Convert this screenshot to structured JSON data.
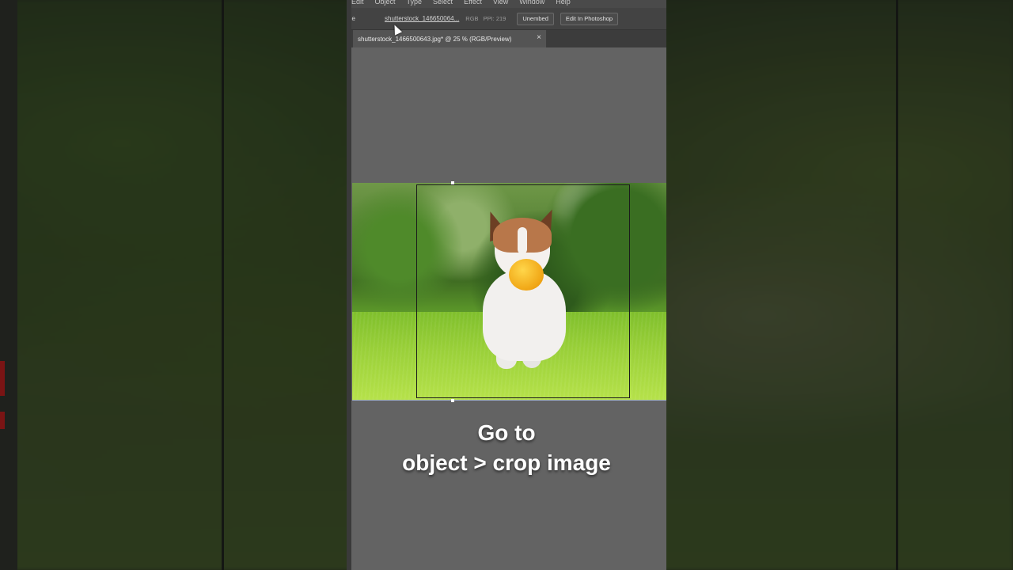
{
  "app": {
    "menu": [
      "Edit",
      "Object",
      "Type",
      "Select",
      "Effect",
      "View",
      "Window",
      "Help"
    ],
    "control_bar": {
      "image_label": "ge",
      "file_name": "shutterstock_146650064...",
      "color_mode": "RGB",
      "ppi": "PPI: 219",
      "unembed_button": "Unembed",
      "edit_photoshop_button": "Edit In Photoshop"
    },
    "document_tab": {
      "title": "shutterstock_1466500643.jpg* @ 25 % (RGB/Preview)",
      "close": "×"
    }
  },
  "caption": {
    "line1": "Go to",
    "line2": "object > crop image"
  },
  "colors": {
    "panel": "#5f5f5f",
    "caption_text": "#ffffff",
    "side_tab": "#7a1414"
  }
}
